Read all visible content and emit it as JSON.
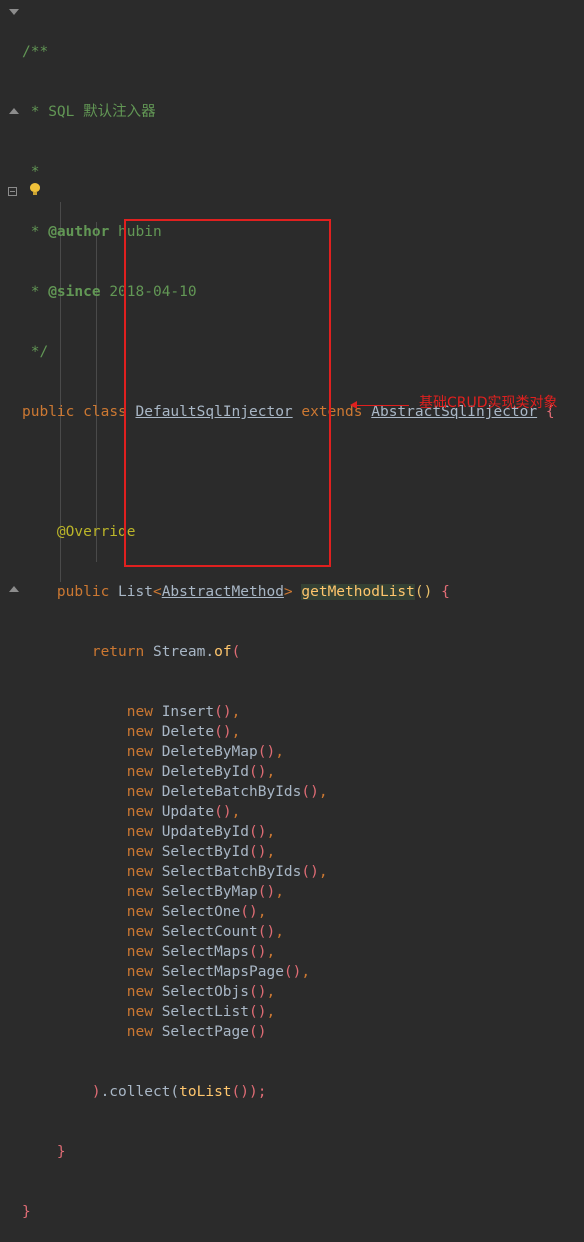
{
  "code": {
    "doc_open": "/**",
    "doc_line1": " * SQL 默认注入器",
    "doc_blank": " *",
    "doc_author_tag": "@author",
    "doc_author_name": " hubin",
    "doc_since_tag": "@since",
    "doc_since_value": " 2018-04-10",
    "doc_close": " */",
    "kw_public": "public",
    "kw_class": "class",
    "class_name": "DefaultSqlInjector",
    "kw_extends": "extends",
    "super_class": "AbstractSqlInjector",
    "brace_open": "{",
    "annotation": "@Override",
    "return_type_prefix": "List",
    "return_type_generic": "AbstractMethod",
    "method_name": "getMethodList",
    "kw_return": "return",
    "stream_call": "Stream",
    "stream_method": "of",
    "kw_new": "new",
    "items": [
      {
        "name": "Insert",
        "sep": ","
      },
      {
        "name": "Delete",
        "sep": ","
      },
      {
        "name": "DeleteByMap",
        "sep": ","
      },
      {
        "name": "DeleteById",
        "sep": ","
      },
      {
        "name": "DeleteBatchByIds",
        "sep": ","
      },
      {
        "name": "Update",
        "sep": ","
      },
      {
        "name": "UpdateById",
        "sep": ","
      },
      {
        "name": "SelectById",
        "sep": ","
      },
      {
        "name": "SelectBatchByIds",
        "sep": ","
      },
      {
        "name": "SelectByMap",
        "sep": ","
      },
      {
        "name": "SelectOne",
        "sep": ","
      },
      {
        "name": "SelectCount",
        "sep": ","
      },
      {
        "name": "SelectMaps",
        "sep": ","
      },
      {
        "name": "SelectMapsPage",
        "sep": ","
      },
      {
        "name": "SelectObjs",
        "sep": ","
      },
      {
        "name": "SelectList",
        "sep": ","
      },
      {
        "name": "SelectPage",
        "sep": ""
      }
    ],
    "collect_prefix": ").collect(",
    "collect_arg": "toList",
    "collect_suffix": "());",
    "method_close": "}",
    "class_close": "}"
  },
  "annotation_label": "基础CRUD实现类对象",
  "colors": {
    "background": "#2b2b2b",
    "keyword": "#cc7832",
    "doc_comment": "#629755",
    "annotation": "#bbb529",
    "method": "#ffc66d",
    "highlight_box": "#e0201f"
  }
}
